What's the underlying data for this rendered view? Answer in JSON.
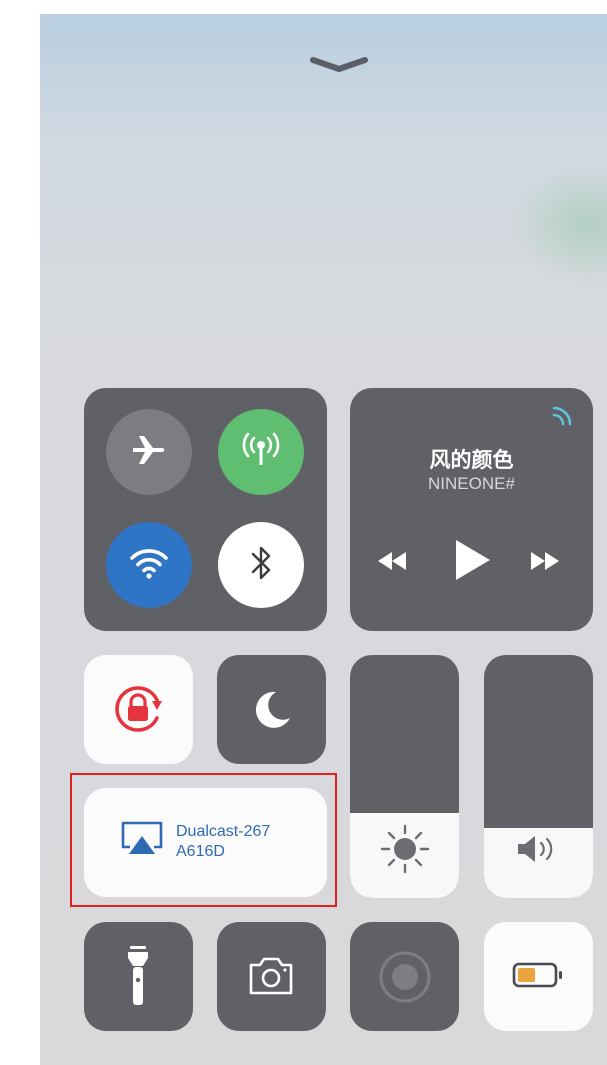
{
  "now_playing": {
    "title": "风的颜色",
    "artist": "NINEONE#"
  },
  "screen_mirroring": {
    "device_line1": "Dualcast-267",
    "device_line2": "A616D"
  },
  "levels": {
    "brightness": 0.35,
    "volume": 0.29
  },
  "toggles": {
    "airplane_mode": false,
    "cellular_data": true,
    "wifi": true,
    "bluetooth": true,
    "orientation_lock": true,
    "do_not_disturb": false
  },
  "icons": {
    "dismiss": "chevron-down-icon",
    "airplane": "airplane-icon",
    "cellular": "cellular-antenna-icon",
    "wifi": "wifi-icon",
    "bluetooth": "bluetooth-icon",
    "airplay": "airplay-audio-icon",
    "previous": "rewind-icon",
    "play": "play-icon",
    "next": "fast-forward-icon",
    "orientation_lock": "orientation-lock-icon",
    "do_not_disturb": "moon-icon",
    "screen_mirroring": "screen-mirroring-icon",
    "brightness": "sun-icon",
    "volume": "speaker-icon",
    "flashlight": "flashlight-icon",
    "camera": "camera-icon",
    "screen_recording": "record-icon",
    "low_power": "battery-icon"
  },
  "colors": {
    "tile_dark": "#5f6167",
    "tile_light": "#fbfbfb",
    "cellular_on": "#5fbe72",
    "wifi_on": "#2f75c6",
    "lock_red": "#e5333f",
    "mirror_blue": "#2e6ab3",
    "battery_fill": "#e9a53b",
    "highlight": "#e02020"
  }
}
